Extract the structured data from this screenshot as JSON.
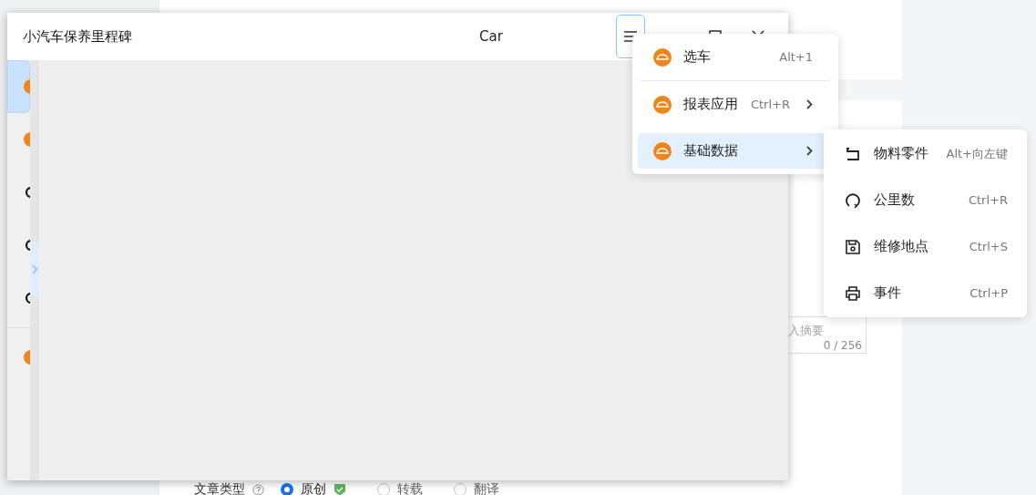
{
  "window": {
    "title": "小汽车保养里程碑",
    "subtitle": "Car"
  },
  "sidebar": {
    "items": [
      {
        "kind": "orange",
        "selected": true
      },
      {
        "kind": "orange",
        "selected": false
      },
      {
        "kind": "dark",
        "selected": false
      },
      {
        "kind": "dark",
        "selected": false
      },
      {
        "kind": "dark",
        "selected": false
      },
      {
        "kind": "divider"
      },
      {
        "kind": "orange",
        "selected": false
      }
    ]
  },
  "menu": {
    "items": [
      {
        "label": "选车",
        "shortcut": "Alt+1",
        "has_submenu": false,
        "selected": false
      },
      {
        "label": "报表应用",
        "shortcut": "Ctrl+R",
        "has_submenu": true,
        "selected": false
      },
      {
        "label": "基础数据",
        "has_submenu": true,
        "selected": true
      }
    ]
  },
  "submenu": {
    "items": [
      {
        "label": "物料零件",
        "shortcut": "Alt+向左键"
      },
      {
        "label": "公里数",
        "shortcut": "Ctrl+R"
      },
      {
        "label": "维修地点",
        "shortcut": "Ctrl+S"
      },
      {
        "label": "事件",
        "shortcut": "Ctrl+P"
      }
    ]
  },
  "background": {
    "summary_field": {
      "placeholder": "入摘要",
      "counter": "0 / 256"
    },
    "article_type": {
      "label": "文章类型",
      "options": [
        {
          "label": "原创",
          "selected": true
        },
        {
          "label": "转载",
          "selected": false
        },
        {
          "label": "翻译",
          "selected": false
        }
      ]
    }
  }
}
